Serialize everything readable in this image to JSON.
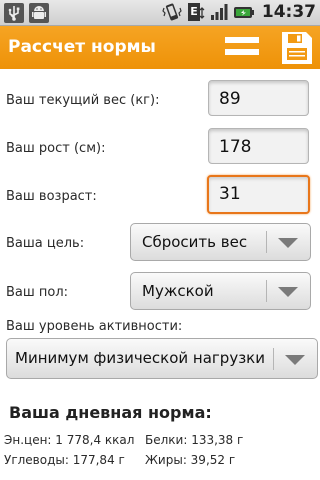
{
  "status_bar": {
    "time": "14:37",
    "left_icons": [
      "usb-icon",
      "android-debug-icon"
    ],
    "right_icons": [
      "vibrate-icon",
      "edge-network-icon",
      "signal-icon",
      "battery-icon"
    ],
    "network_letter": "E"
  },
  "action_bar": {
    "title": "Рассчет нормы",
    "menu_icon": "menu-icon",
    "save_icon": "save-icon"
  },
  "form": {
    "weight": {
      "label": "Ваш текущий вес (кг):",
      "value": "89"
    },
    "height": {
      "label": "Ваш рост (см):",
      "value": "178"
    },
    "age": {
      "label": "Ваш возраст:",
      "value": "31"
    },
    "goal": {
      "label": "Ваша цель:",
      "selected": "Сбросить вес"
    },
    "sex": {
      "label": "Ваш пол:",
      "selected": "Мужской"
    },
    "activity": {
      "label": "Ваш уровень активности:",
      "selected": "Минимум физической нагрузки"
    }
  },
  "result": {
    "title": "Ваша дневная норма:",
    "energy": "Эн.цен: 1 778,4 ккал",
    "protein": "Белки: 133,38 г",
    "carbs": "Углеводы: 177,84 г",
    "fat": "Жиры: 39,52 г"
  },
  "colors": {
    "accent": "#f29a12",
    "focus": "#e8761a"
  }
}
